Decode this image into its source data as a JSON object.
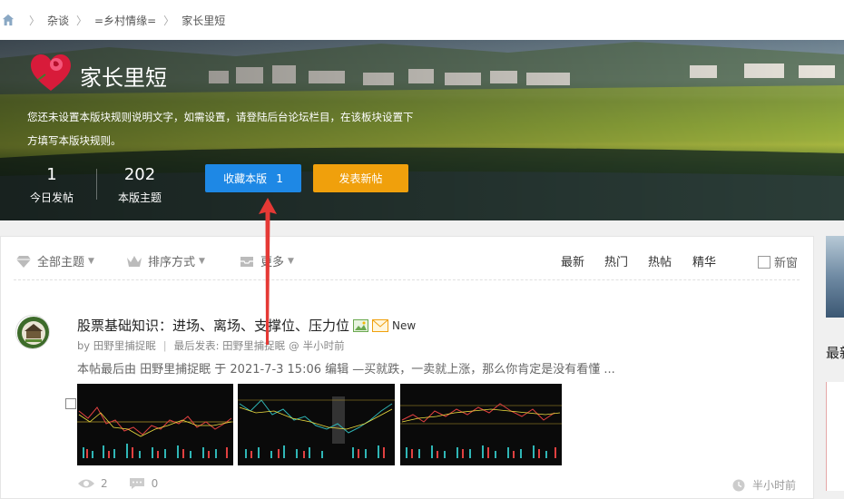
{
  "breadcrumb": {
    "items": [
      "杂谈",
      "=乡村情缘=",
      "家长里短"
    ]
  },
  "forum": {
    "title": "家长里短",
    "rules": "您还未设置本版块规则说明文字，如需设置，请登陆后台论坛栏目，在该板块设置下方填写本版块规则。",
    "stats": [
      {
        "value": "1",
        "label": "今日发帖"
      },
      {
        "value": "202",
        "label": "本版主题"
      }
    ],
    "fav_label": "收藏本版",
    "fav_count": "1",
    "post_label": "发表新帖"
  },
  "filters": {
    "all": "全部主题",
    "sort": "排序方式",
    "more": "更多"
  },
  "sort_tabs": [
    "最新",
    "热门",
    "热帖",
    "精华"
  ],
  "new_window": "新窗",
  "thread": {
    "title": "股票基础知识：进场、离场、支撑位、压力位",
    "new_badge": "New",
    "author": "by 田野里捕捉眠",
    "last_post_label": "最后发表: 田野里捕捉眠",
    "last_post_at": "@",
    "last_post_time": "半小时前",
    "excerpt": "本帖最后由 田野里捕捉眠 于 2021-7-3 15:06 编辑 —买就跌，一卖就上涨，那么你肯定是没有看懂 ...",
    "views": "2",
    "replies": "0",
    "time": "半小时前"
  },
  "sidebar": {
    "title": "最新"
  },
  "colors": {
    "fav_button": "#1e88e5",
    "post_button": "#f0a00c",
    "annotation_arrow": "#e53935"
  }
}
